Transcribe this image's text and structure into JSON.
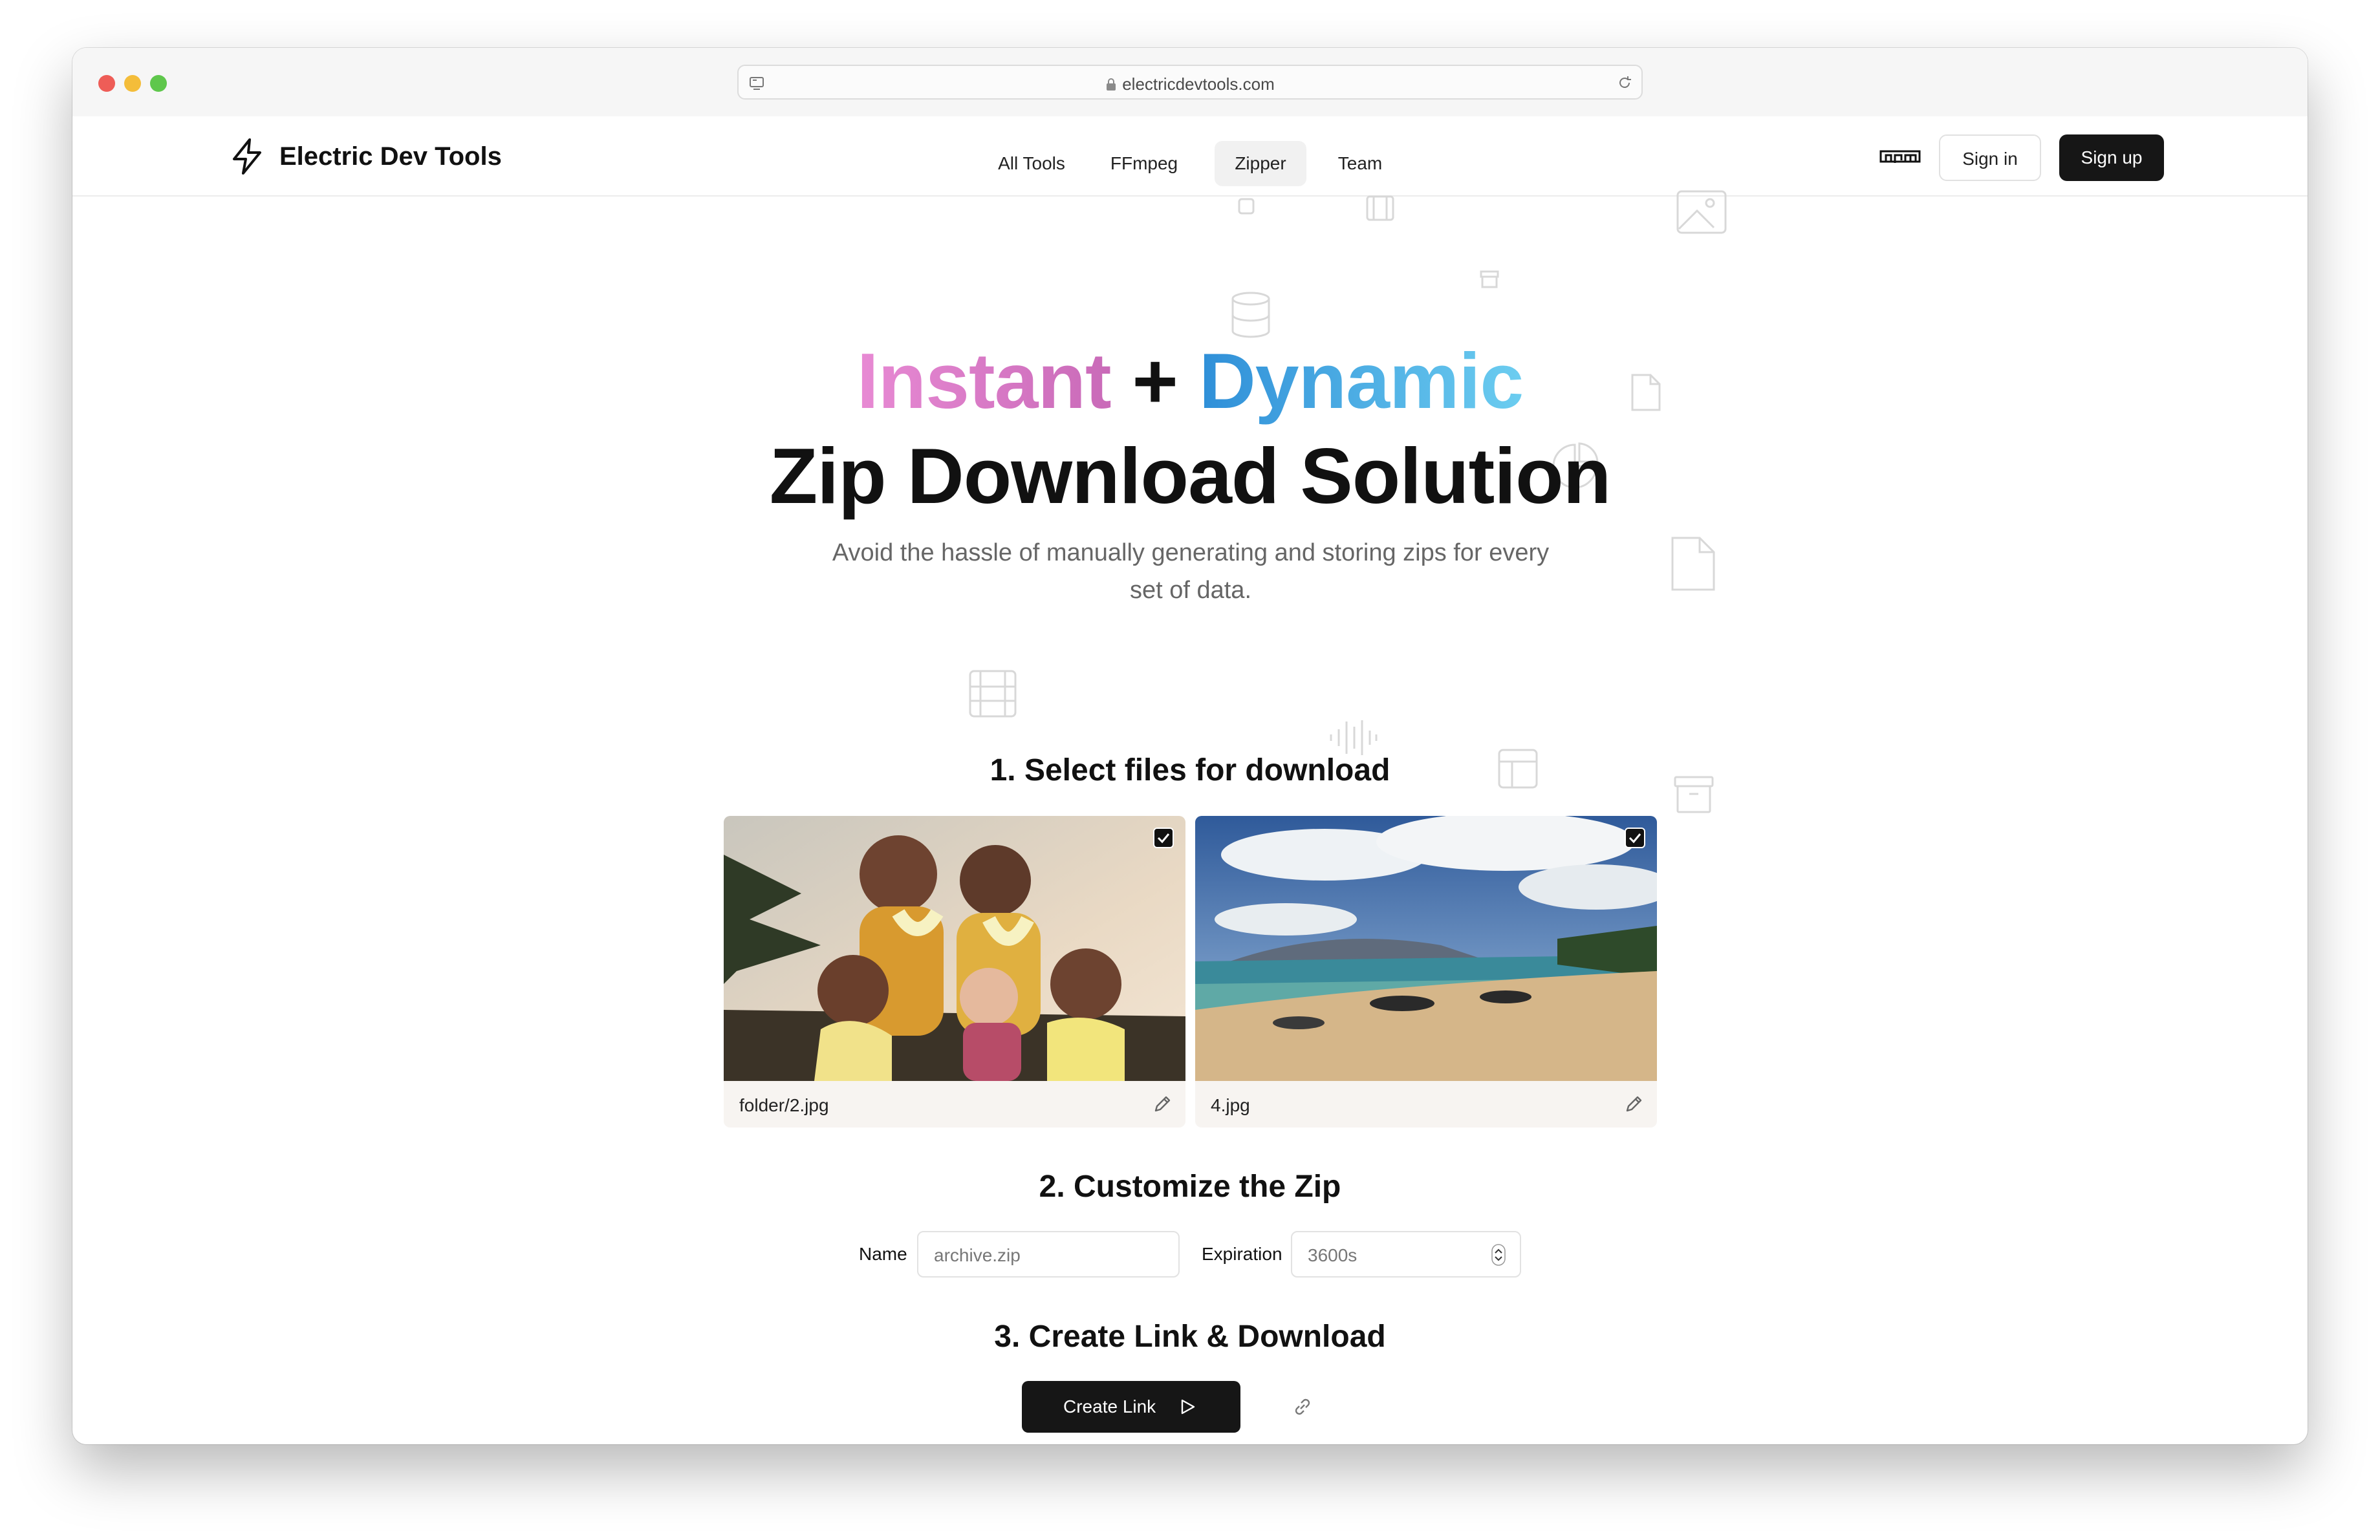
{
  "browser": {
    "url": "electricdevtools.com"
  },
  "brand": {
    "name": "Electric Dev Tools"
  },
  "nav": {
    "links": [
      {
        "label": "All Tools"
      },
      {
        "label": "FFmpeg"
      },
      {
        "label": "Zipper",
        "active": true
      },
      {
        "label": "Team"
      }
    ],
    "npm_icon": "npm-icon",
    "sign_in": "Sign in",
    "sign_up": "Sign up"
  },
  "hero": {
    "word_instant": "Instant",
    "plus": "+",
    "word_dynamic": "Dynamic",
    "title_line2": "Zip Download Solution",
    "subtitle": "Avoid the hassle of manually generating and storing zips for every set of data."
  },
  "step1": {
    "heading": "1. Select files for download",
    "files": [
      {
        "name": "folder/2.jpg",
        "selected": true,
        "image": "photo of a group in leis"
      },
      {
        "name": "4.jpg",
        "selected": true,
        "image": "photo of a beach"
      }
    ]
  },
  "step2": {
    "heading": "2. Customize the Zip",
    "name_label": "Name",
    "name_placeholder": "archive.zip",
    "expiration_label": "Expiration",
    "expiration_value": "3600s"
  },
  "step3": {
    "heading": "3. Create Link & Download",
    "button_label": "Create Link",
    "link_icon": "link-icon"
  },
  "colors": {
    "accent_dark": "#161616",
    "gradient_pink": "#e88ad4",
    "gradient_blue": "#2f8fd8"
  }
}
